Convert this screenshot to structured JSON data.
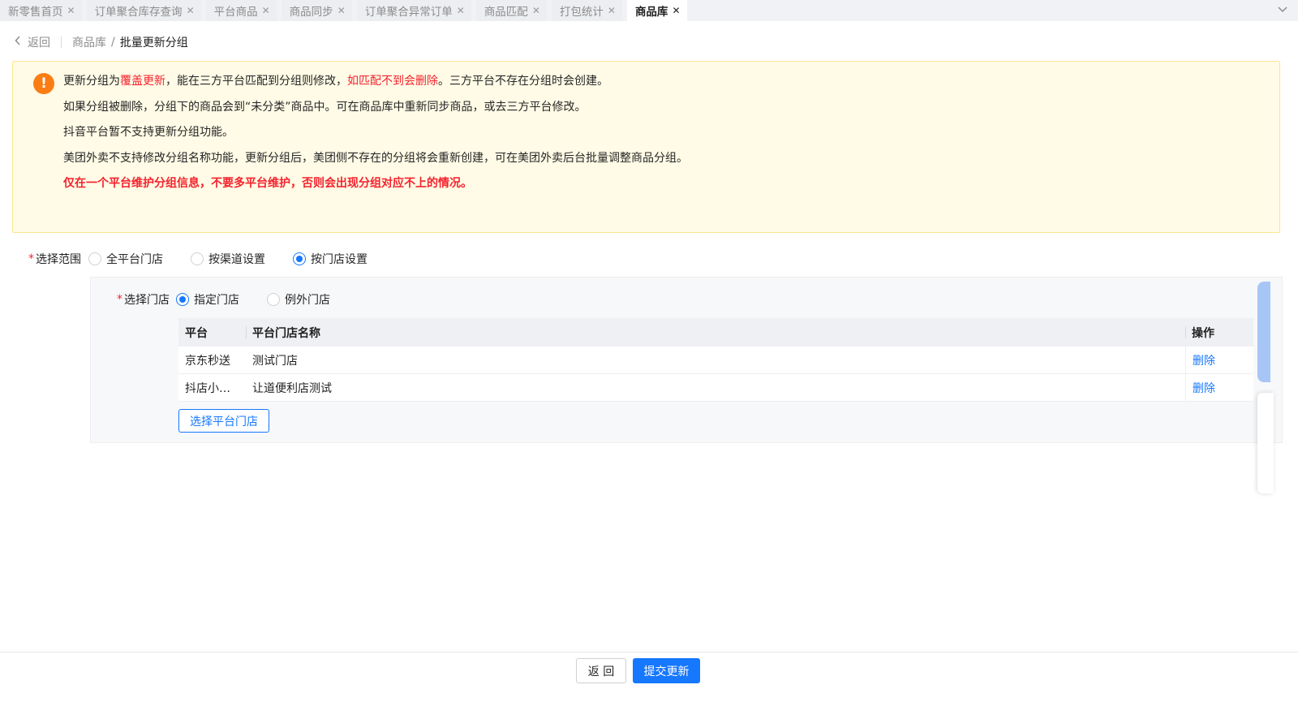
{
  "tabs": [
    {
      "label": "新零售首页",
      "active": false
    },
    {
      "label": "订单聚合库存查询",
      "active": false
    },
    {
      "label": "平台商品",
      "active": false
    },
    {
      "label": "商品同步",
      "active": false
    },
    {
      "label": "订单聚合异常订单",
      "active": false
    },
    {
      "label": "商品匹配",
      "active": false
    },
    {
      "label": "打包统计",
      "active": false
    },
    {
      "label": "商品库",
      "active": true
    }
  ],
  "tab_close_glyph": "✕",
  "breadcrumb": {
    "back_label": "返回",
    "parent": "商品库",
    "separator": "/",
    "current": "批量更新分组"
  },
  "notice": {
    "line1": {
      "a": "更新分组为",
      "b": "覆盖更新",
      "c": "，能在三方平台匹配到分组则修改，",
      "d": "如匹配不到会删除",
      "e": "。三方平台不存在分组时会创建。"
    },
    "line2": "如果分组被删除，分组下的商品会到“未分类”商品中。可在商品库中重新同步商品，或去三方平台修改。",
    "line3": "抖音平台暂不支持更新分组功能。",
    "line4": "美团外卖不支持修改分组名称功能，更新分组后，美团侧不存在的分组将会重新创建，可在美团外卖后台批量调整商品分组。",
    "line5": "仅在一个平台维护分组信息，不要多平台维护，否则会出现分组对应不上的情况。"
  },
  "scope": {
    "label": "选择范围",
    "options": [
      "全平台门店",
      "按渠道设置",
      "按门店设置"
    ],
    "selected": "按门店设置"
  },
  "store_select": {
    "label": "选择门店",
    "options": [
      "指定门店",
      "例外门店"
    ],
    "selected": "指定门店"
  },
  "table": {
    "columns": [
      "平台",
      "平台门店名称",
      "操作"
    ],
    "rows": [
      {
        "platform": "京东秒送",
        "store": "测试门店",
        "action": "删除"
      },
      {
        "platform": "抖店小…",
        "store": "让道便利店测试",
        "action": "删除"
      }
    ]
  },
  "select_store_button": "选择平台门店",
  "footer": {
    "back_button": "返 回",
    "submit_button": "提交更新"
  }
}
